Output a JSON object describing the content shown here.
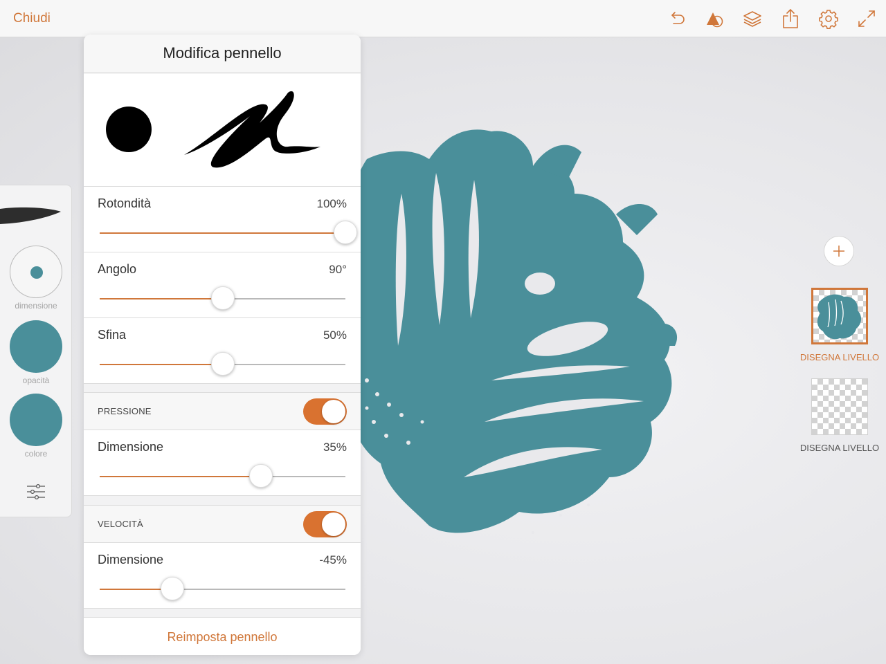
{
  "topbar": {
    "close_label": "Chiudi",
    "icons": [
      "undo-icon",
      "shapes-icon",
      "layers-icon",
      "share-icon",
      "gear-icon",
      "fullscreen-icon"
    ]
  },
  "colors": {
    "accent": "#d0773a",
    "brush_color": "#4a8f9a",
    "toggle_on": "#d97230"
  },
  "tools": {
    "size_label": "dimensione",
    "opacity_label": "opacità",
    "color_label": "colore"
  },
  "panel": {
    "title": "Modifica pennello",
    "roundness": {
      "label": "Rotondità",
      "value": "100%",
      "level": 1.0
    },
    "angle": {
      "label": "Angolo",
      "value": "90°",
      "level": 0.5
    },
    "taper": {
      "label": "Sfina",
      "value": "50%",
      "level": 0.5
    },
    "pressure": {
      "toggle_label": "PRESSIONE",
      "enabled": true,
      "size_label": "Dimensione",
      "size_value": "35%",
      "level": 0.655
    },
    "velocity": {
      "toggle_label": "VELOCITÀ",
      "enabled": true,
      "size_label": "Dimensione",
      "size_value": "-45%",
      "level": 0.295
    },
    "reset_label": "Reimposta pennello"
  },
  "layers": {
    "items": [
      {
        "label": "DISEGNA LIVELLO",
        "active": true
      },
      {
        "label": "DISEGNA LIVELLO",
        "active": false
      }
    ]
  }
}
